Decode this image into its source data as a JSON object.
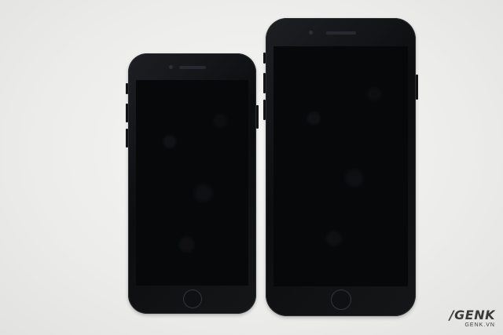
{
  "scene": {
    "description_objects": [
      "phone-small",
      "phone-large"
    ]
  },
  "watermark": {
    "main": "/GENK",
    "sub": "GENK.VN"
  },
  "colors": {
    "background": "#ececea",
    "phone_body": "#121315",
    "screen": "#070809"
  }
}
